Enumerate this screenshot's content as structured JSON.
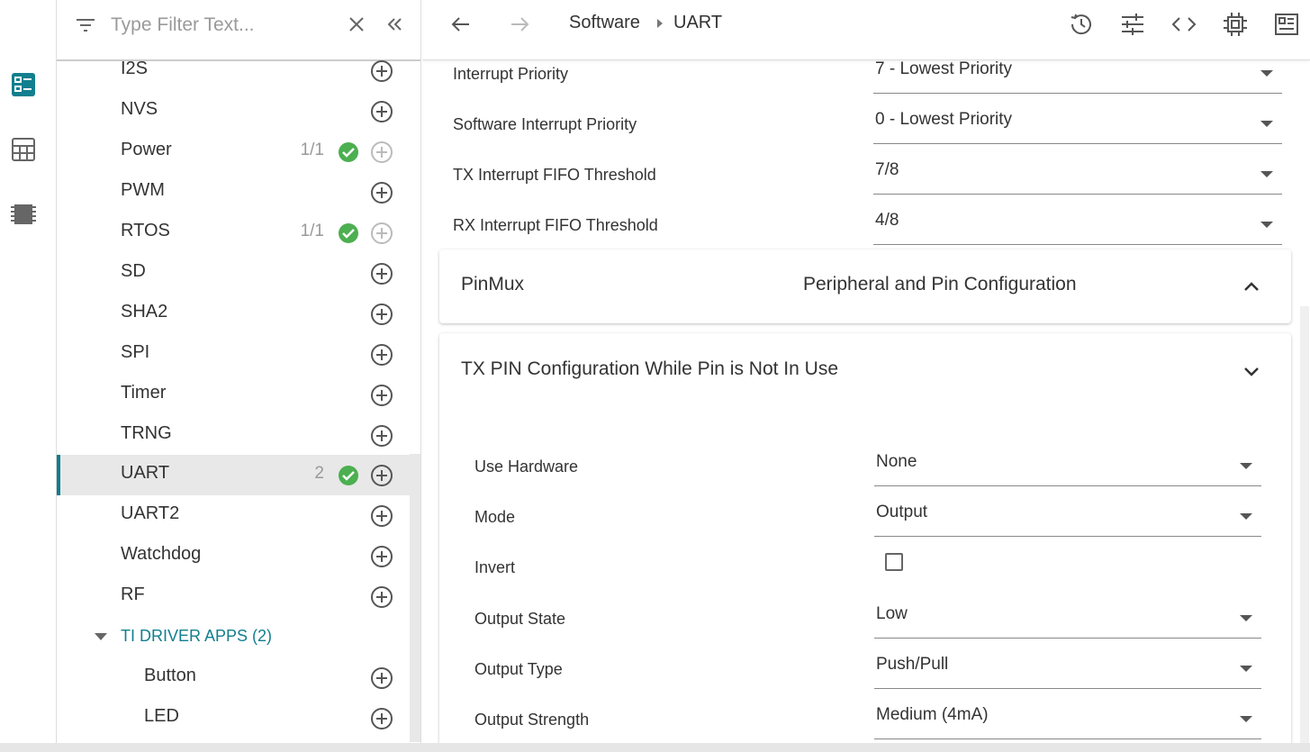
{
  "filter": {
    "placeholder": "Type Filter Text..."
  },
  "sidebar": {
    "items": [
      {
        "label": "I2S"
      },
      {
        "label": "NVS"
      },
      {
        "label": "Power",
        "count": "1/1"
      },
      {
        "label": "PWM"
      },
      {
        "label": "RTOS",
        "count": "1/1"
      },
      {
        "label": "SD"
      },
      {
        "label": "SHA2"
      },
      {
        "label": "SPI"
      },
      {
        "label": "Timer"
      },
      {
        "label": "TRNG"
      },
      {
        "label": "UART",
        "count": "2"
      },
      {
        "label": "UART2"
      },
      {
        "label": "Watchdog"
      },
      {
        "label": "RF"
      }
    ],
    "group": {
      "label": "TI DRIVER APPS (2)"
    },
    "subitems": [
      {
        "label": "Button"
      },
      {
        "label": "LED"
      }
    ]
  },
  "breadcrumb": {
    "parent": "Software",
    "current": "UART"
  },
  "settings": [
    {
      "label": "Interrupt Priority",
      "value": "7 - Lowest Priority"
    },
    {
      "label": "Software Interrupt Priority",
      "value": "0 - Lowest Priority"
    },
    {
      "label": "TX Interrupt FIFO Threshold",
      "value": "7/8"
    },
    {
      "label": "RX Interrupt FIFO Threshold",
      "value": "4/8"
    }
  ],
  "pinmux": {
    "title": "PinMux",
    "subtitle": "Peripheral and Pin Configuration"
  },
  "tx_pin": {
    "title": "TX PIN Configuration While Pin is Not In Use",
    "rows": [
      {
        "label": "Use Hardware",
        "value": "None"
      },
      {
        "label": "Mode",
        "value": "Output"
      },
      {
        "label": "Invert"
      },
      {
        "label": "Output State",
        "value": "Low"
      },
      {
        "label": "Output Type",
        "value": "Push/Pull"
      },
      {
        "label": "Output Strength",
        "value": "Medium (4mA)"
      }
    ]
  },
  "colors": {
    "accent": "#127f8e",
    "success": "#4caf50"
  }
}
